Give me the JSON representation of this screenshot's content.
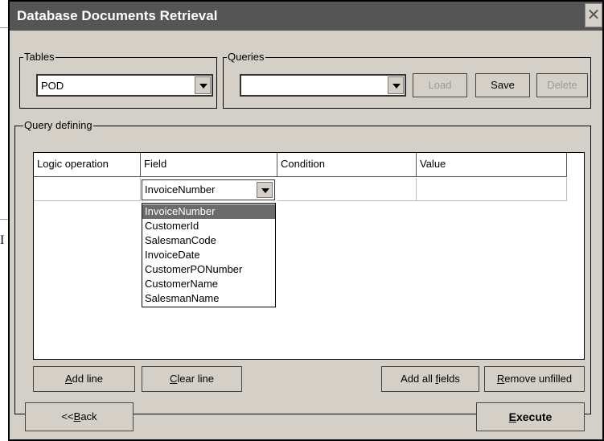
{
  "window": {
    "title": "Database Documents Retrieval",
    "close_glyph": "✕"
  },
  "background": {
    "glyph": "I"
  },
  "tables": {
    "legend": "Tables",
    "value": "POD"
  },
  "queries": {
    "legend": "Queries",
    "value": "",
    "load_label": "Load",
    "save_label": "Save",
    "delete_label": "Delete"
  },
  "query_defining": {
    "legend": "Query defining",
    "columns": [
      "Logic operation",
      "Field",
      "Condition",
      "Value"
    ],
    "row": {
      "logic": "",
      "field": "InvoiceNumber",
      "condition": "",
      "value": ""
    },
    "field_options": [
      "InvoiceNumber",
      "CustomerId",
      "SalesmanCode",
      "InvoiceDate",
      "CustomerPONumber",
      "CustomerName",
      "SalesmanName"
    ],
    "selected_option": "InvoiceNumber",
    "add_line": {
      "underline": "A",
      "rest": "dd line"
    },
    "clear_line": {
      "underline": "C",
      "rest": "lear line"
    },
    "add_all_fields": {
      "prefix": "Add all ",
      "underline": "f",
      "rest": "ields"
    },
    "remove_unfilled": {
      "underline": "R",
      "rest": "emove unfilled"
    }
  },
  "footer": {
    "back": {
      "prefix": "<<",
      "underline": "B",
      "rest": "ack"
    },
    "execute": {
      "underline": "E",
      "rest": "xecute"
    }
  },
  "colors": {
    "title_bar": "#555555",
    "selection": "#6b6b6b",
    "face": "#d4d0c8"
  }
}
